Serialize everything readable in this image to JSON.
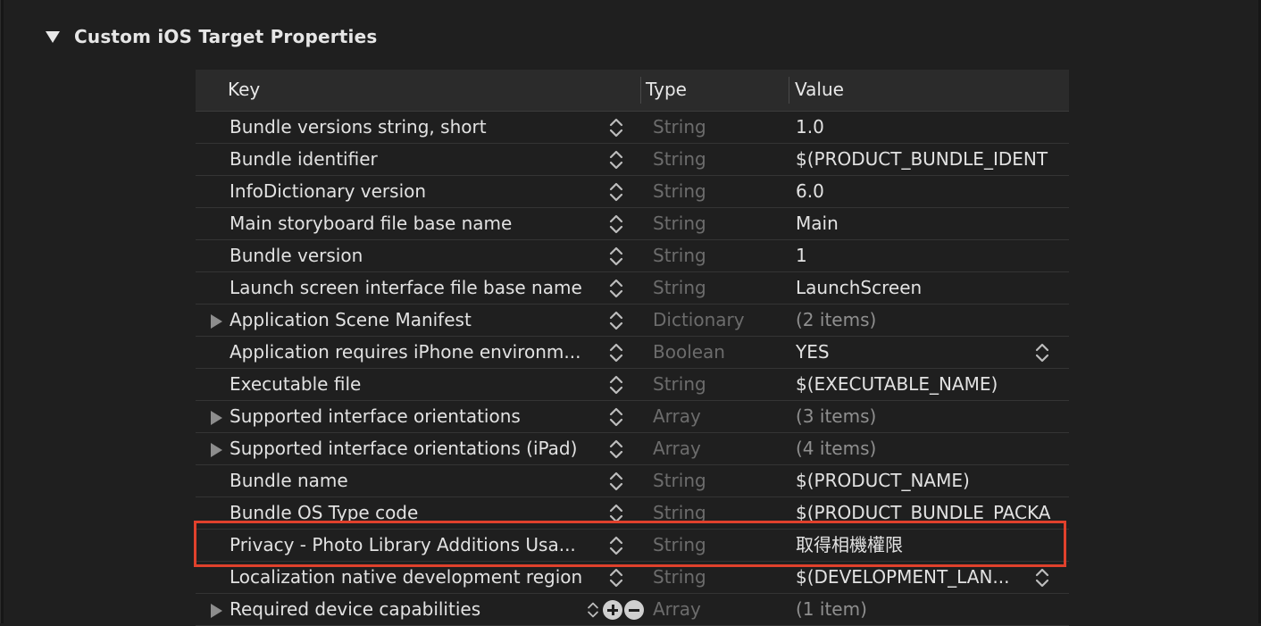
{
  "section": {
    "title": "Custom iOS Target Properties"
  },
  "columns": {
    "key": "Key",
    "type": "Type",
    "value": "Value"
  },
  "rows": [
    {
      "key": "Bundle versions string, short",
      "type": "String",
      "value": "1.0",
      "expandable": false,
      "value_muted": false
    },
    {
      "key": "Bundle identifier",
      "type": "String",
      "value": "$(PRODUCT_BUNDLE_IDENT",
      "expandable": false,
      "value_muted": false
    },
    {
      "key": "InfoDictionary version",
      "type": "String",
      "value": "6.0",
      "expandable": false,
      "value_muted": false
    },
    {
      "key": "Main storyboard file base name",
      "type": "String",
      "value": "Main",
      "expandable": false,
      "value_muted": false
    },
    {
      "key": "Bundle version",
      "type": "String",
      "value": "1",
      "expandable": false,
      "value_muted": false
    },
    {
      "key": "Launch screen interface file base name",
      "type": "String",
      "value": "LaunchScreen",
      "expandable": false,
      "value_muted": false
    },
    {
      "key": "Application Scene Manifest",
      "type": "Dictionary",
      "value": "(2 items)",
      "expandable": true,
      "value_muted": true
    },
    {
      "key": "Application requires iPhone environm...",
      "type": "Boolean",
      "value": "YES",
      "expandable": false,
      "value_muted": false,
      "value_stepper": true
    },
    {
      "key": "Executable file",
      "type": "String",
      "value": "$(EXECUTABLE_NAME)",
      "expandable": false,
      "value_muted": false
    },
    {
      "key": "Supported interface orientations",
      "type": "Array",
      "value": "(3 items)",
      "expandable": true,
      "value_muted": true
    },
    {
      "key": "Supported interface orientations (iPad)",
      "type": "Array",
      "value": "(4 items)",
      "expandable": true,
      "value_muted": true
    },
    {
      "key": "Bundle name",
      "type": "String",
      "value": "$(PRODUCT_NAME)",
      "expandable": false,
      "value_muted": false
    },
    {
      "key": "Bundle OS Type code",
      "type": "String",
      "value": "$(PRODUCT_BUNDLE_PACKA",
      "expandable": false,
      "value_muted": false
    },
    {
      "key": "Privacy - Photo Library Additions Usa...",
      "type": "String",
      "value": "取得相機權限",
      "expandable": false,
      "value_muted": false,
      "highlighted": true
    },
    {
      "key": "Localization native development region",
      "type": "String",
      "value": "$(DEVELOPMENT_LAN...",
      "expandable": false,
      "value_muted": false,
      "value_stepper": true
    },
    {
      "key": "Required device capabilities",
      "type": "Array",
      "value": "(1 item)",
      "expandable": true,
      "value_muted": true,
      "add_remove": true
    }
  ],
  "colors": {
    "highlight": "#e0412c",
    "background": "#1f1f1f"
  },
  "icons": {
    "section_toggle": "disclosure-down-icon",
    "row_toggle": "disclosure-right-icon",
    "stepper": "up-down-stepper-icon",
    "add": "plus-circle-icon",
    "remove": "minus-circle-icon"
  }
}
